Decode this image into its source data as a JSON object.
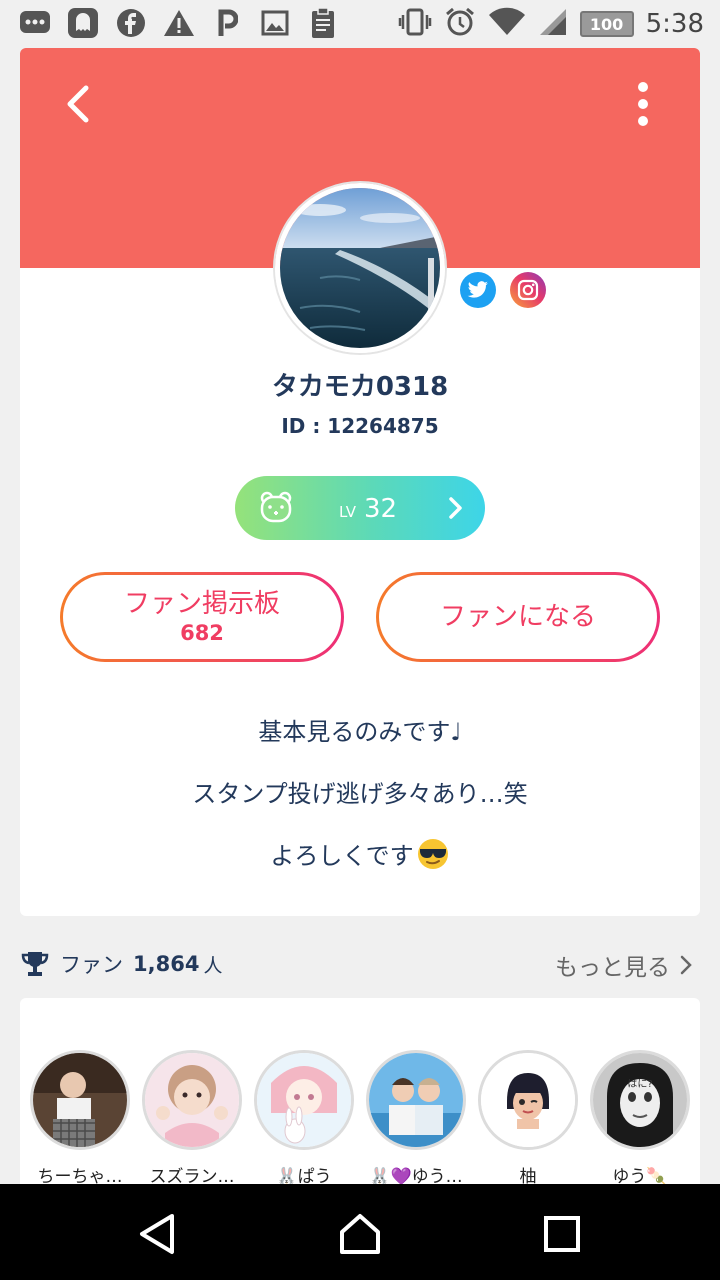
{
  "status_bar": {
    "time": "5:38",
    "battery": "100",
    "left_icons": [
      "messages-icon",
      "ghost-app-icon",
      "facebook-icon",
      "warning-icon",
      "p-app-icon",
      "image-icon",
      "clipboard-icon"
    ],
    "right_icons": [
      "vibrate-icon",
      "alarm-icon",
      "wifi-icon",
      "signal-icon"
    ]
  },
  "profile": {
    "username": "タカモカ0318",
    "user_id": "ID : 12264875",
    "social": [
      "twitter-icon",
      "instagram-icon"
    ],
    "level": {
      "prefix": "LV",
      "value": "32"
    },
    "fanboard_button": {
      "label": "ファン掲示板",
      "count": "682"
    },
    "become_fan_button": {
      "label": "ファンになる"
    },
    "bio": [
      "基本見るのみです♩",
      "スタンプ投げ逃げ多々あり…笑",
      "よろしくです"
    ]
  },
  "fans": {
    "label": "ファン",
    "count": "1,864",
    "unit": "人",
    "see_more": "もっと見る",
    "list": [
      {
        "name": "ちーちゃ…"
      },
      {
        "name": "スズラン…"
      },
      {
        "name": "🐰ぱう"
      },
      {
        "name": "🐰💜ゆう…"
      },
      {
        "name": "柚"
      },
      {
        "name": "ゆう🍡"
      }
    ]
  },
  "colors": {
    "header": "#f5675f",
    "accent_gradient": [
      "#f57b2a",
      "#ee2e77"
    ],
    "level_gradient": [
      "#95e27a",
      "#3dd5e8"
    ],
    "text_primary": "#23395b"
  },
  "nav_bar": [
    "back-nav-icon",
    "home-nav-icon",
    "recents-nav-icon"
  ]
}
